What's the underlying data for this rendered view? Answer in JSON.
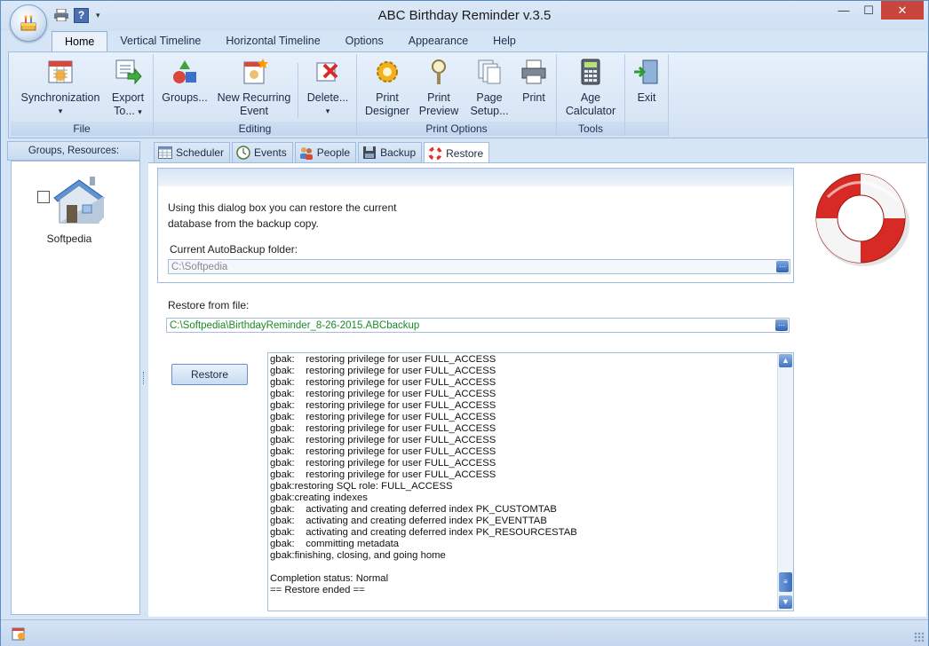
{
  "window": {
    "title": "ABC Birthday Reminder v.3.5"
  },
  "ribbon_tabs": [
    "Home",
    "Vertical Timeline",
    "Horizontal Timeline",
    "Options",
    "Appearance",
    "Help"
  ],
  "ribbon": {
    "file": {
      "label": "File",
      "sync": "Synchronization",
      "export1": "Export",
      "export2": "To..."
    },
    "editing": {
      "label": "Editing",
      "groups": "Groups...",
      "newrec1": "New Recurring",
      "newrec2": "Event",
      "delete": "Delete..."
    },
    "print": {
      "label": "Print Options",
      "designer1": "Print",
      "designer2": "Designer",
      "preview1": "Print",
      "preview2": "Preview",
      "setup1": "Page",
      "setup2": "Setup...",
      "print": "Print"
    },
    "tools": {
      "label": "Tools",
      "age1": "Age",
      "age2": "Calculator"
    },
    "exit": {
      "label": "Exit"
    }
  },
  "left_panel": {
    "header": "Groups, Resources:",
    "item": "Softpedia"
  },
  "content_tabs": [
    "Scheduler",
    "Events",
    "People",
    "Backup",
    "Restore"
  ],
  "restore": {
    "info_line1": "Using this dialog box you can restore the current",
    "info_line2": "database from the backup copy.",
    "autobackup_label": "Current AutoBackup folder:",
    "autobackup_value": "C:\\Softpedia",
    "restore_from_label": "Restore from file:",
    "restore_from_value": "C:\\Softpedia\\BirthdayReminder_8-26-2015.ABCbackup",
    "restore_button": "Restore",
    "log": "gbak:    restoring privilege for user FULL_ACCESS\ngbak:    restoring privilege for user FULL_ACCESS\ngbak:    restoring privilege for user FULL_ACCESS\ngbak:    restoring privilege for user FULL_ACCESS\ngbak:    restoring privilege for user FULL_ACCESS\ngbak:    restoring privilege for user FULL_ACCESS\ngbak:    restoring privilege for user FULL_ACCESS\ngbak:    restoring privilege for user FULL_ACCESS\ngbak:    restoring privilege for user FULL_ACCESS\ngbak:    restoring privilege for user FULL_ACCESS\ngbak:    restoring privilege for user FULL_ACCESS\ngbak:restoring SQL role: FULL_ACCESS\ngbak:creating indexes\ngbak:    activating and creating deferred index PK_CUSTOMTAB\ngbak:    activating and creating deferred index PK_EVENTTAB\ngbak:    activating and creating deferred index PK_RESOURCESTAB\ngbak:    committing metadata\ngbak:finishing, closing, and going home\n\nCompletion status: Normal\n== Restore ended =="
  }
}
